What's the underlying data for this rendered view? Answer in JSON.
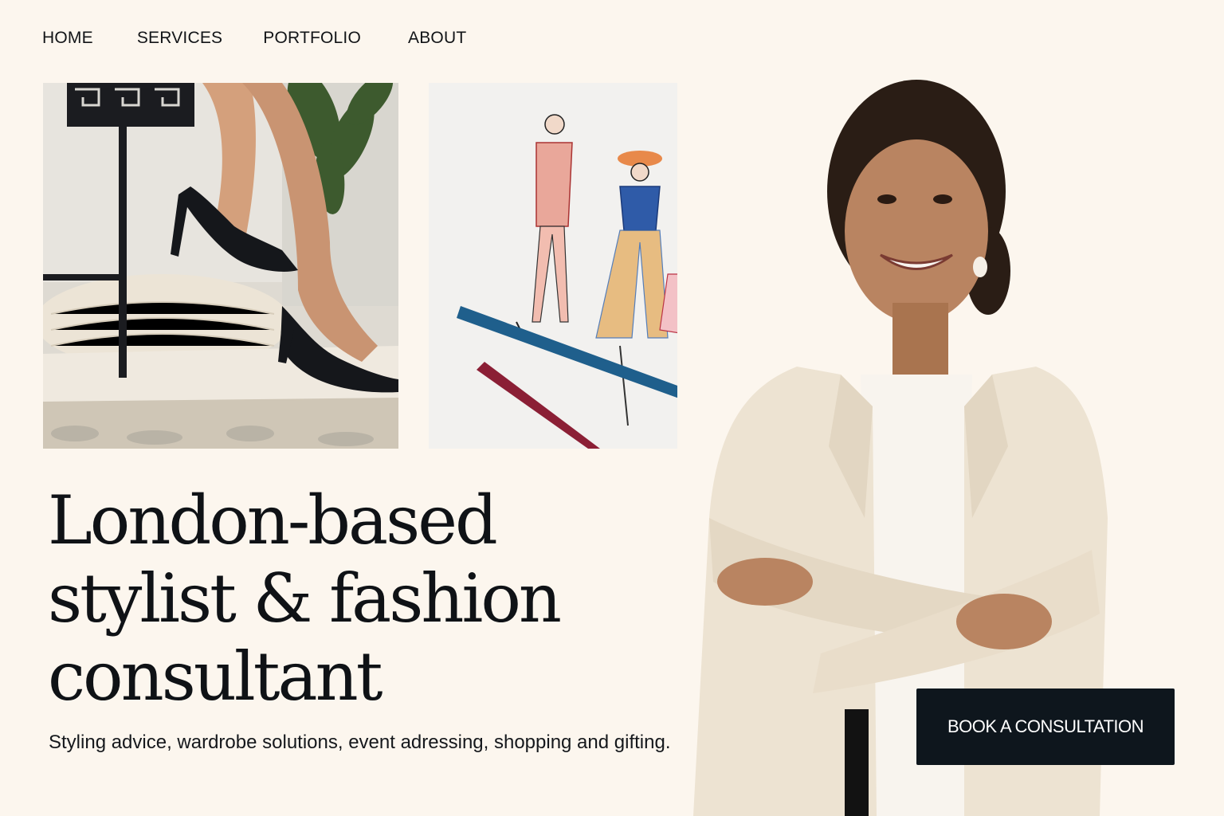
{
  "nav": {
    "items": [
      "HOME",
      "SERVICES",
      "PORTFOLIO",
      "ABOUT"
    ]
  },
  "hero": {
    "headline_lines": [
      "London-based",
      "stylist & fashion",
      "consultant"
    ],
    "subline": "Styling advice, wardrobe solutions, event adressing, shopping and gifting.",
    "cta_label": "BOOK A CONSULTATION"
  },
  "images": {
    "shoes_alt": "legs-in-black-heels-photo",
    "sketches_alt": "fashion-sketches-photo",
    "portrait_alt": "stylist-portrait-photo"
  },
  "colors": {
    "background": "#fcf6ee",
    "text": "#0f1216",
    "cta_background": "#0e161d",
    "cta_text": "#ffffff"
  }
}
